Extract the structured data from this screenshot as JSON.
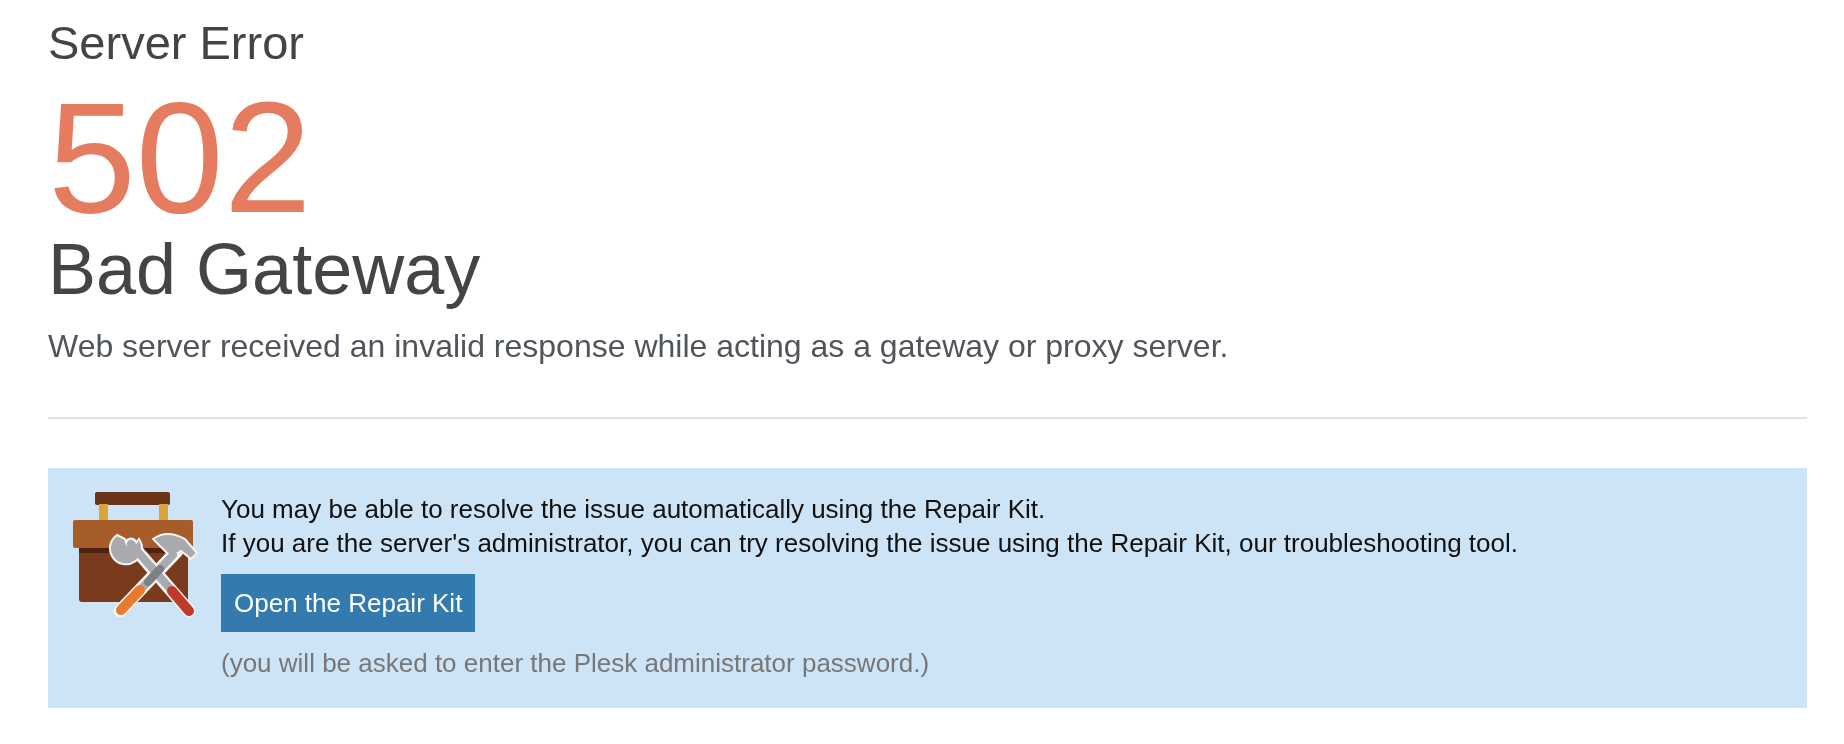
{
  "header": {
    "title": "Server Error",
    "code": "502",
    "status": "Bad Gateway",
    "description": "Web server received an invalid response while acting as a gateway or proxy server."
  },
  "repair_panel": {
    "messages": [
      "You may be able to resolve the issue automatically using the Repair Kit.",
      "If you are the server's administrator, you can try resolving the issue using the Repair Kit, our troubleshooting tool."
    ],
    "button": "Open the Repair Kit",
    "note": "(you will be asked to enter the Plesk administrator password.)"
  }
}
